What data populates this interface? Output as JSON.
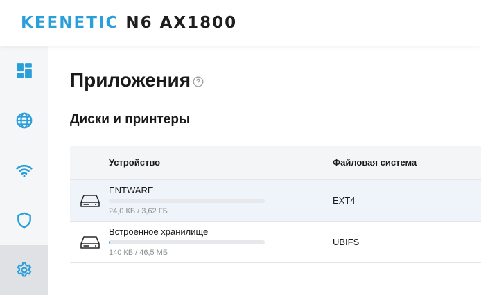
{
  "header": {
    "brand_name": "KEENETIC",
    "model": "N6 AX1800"
  },
  "sidebar": {
    "items": [
      {
        "icon": "dashboard-icon",
        "active": false
      },
      {
        "icon": "globe-icon",
        "active": false
      },
      {
        "icon": "wifi-icon",
        "active": false
      },
      {
        "icon": "shield-icon",
        "active": false
      },
      {
        "icon": "gear-icon",
        "active": true
      }
    ]
  },
  "page": {
    "title": "Приложения",
    "help_icon": "help-circle-icon",
    "section_title": "Диски и принтеры"
  },
  "table": {
    "headers": {
      "device": "Устройство",
      "filesystem": "Файловая система"
    },
    "rows": [
      {
        "name": "ENTWARE",
        "size": "24,0 КБ / 3,62 ГБ",
        "usage_fraction": 0.0,
        "filesystem": "EXT4",
        "icon": "hard-drive-icon"
      },
      {
        "name": "Встроенное хранилище",
        "size": "140 КБ / 46,5 МБ",
        "usage_fraction": 0.003,
        "filesystem": "UBIFS",
        "icon": "hard-drive-icon"
      }
    ]
  },
  "colors": {
    "accent": "#2b9fd9",
    "sidebar_bg": "#f5f6f7",
    "sidebar_active_bg": "#dfe1e4",
    "row_hover_bg": "#eef4f9"
  }
}
